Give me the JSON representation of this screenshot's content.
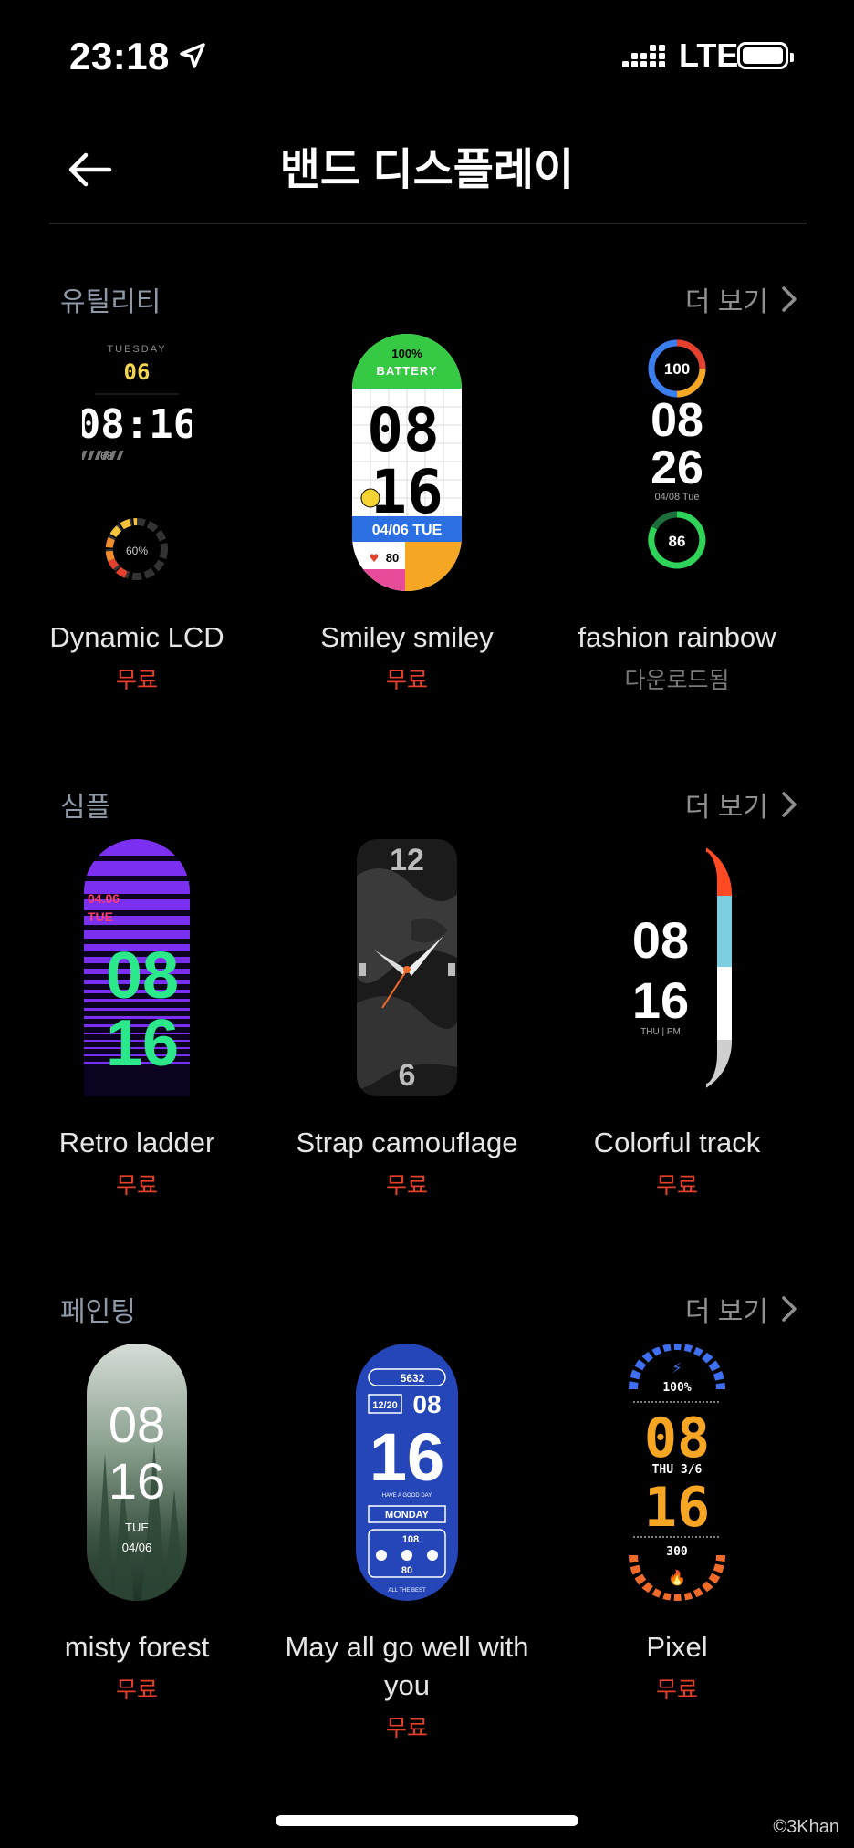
{
  "status_bar": {
    "time": "23:18",
    "network": "LTE"
  },
  "header": {
    "title": "밴드 디스플레이"
  },
  "sections": [
    {
      "title": "유틸리티",
      "more_label": "더 보기",
      "items": [
        {
          "name": "Dynamic LCD",
          "price": "무료",
          "face": {
            "day": "TUESDAY",
            "date": "06",
            "time": "08:16",
            "steps": "68",
            "percent": "60%"
          }
        },
        {
          "name": "Smiley smiley",
          "price": "무료",
          "face": {
            "battery": "100%",
            "battery_label": "BATTERY",
            "hour": "08",
            "minute": "16",
            "date": "04/06 TUE",
            "heart": "80"
          }
        },
        {
          "name": "fashion rainbow",
          "price": "다운로드됨",
          "face": {
            "top": "100",
            "hour": "08",
            "minute": "26",
            "date": "04/08 Tue",
            "bottom": "86"
          }
        }
      ]
    },
    {
      "title": "심플",
      "more_label": "더 보기",
      "items": [
        {
          "name": "Retro ladder",
          "price": "무료",
          "face": {
            "date": "04.06",
            "day": "TUE",
            "hour": "08",
            "minute": "16"
          }
        },
        {
          "name": "Strap camouflage",
          "price": "무료",
          "face": {
            "twelve": "12",
            "six": "6"
          }
        },
        {
          "name": "Colorful track",
          "price": "무료",
          "face": {
            "hour": "08",
            "minute": "16",
            "sub": "THU | PM"
          }
        }
      ]
    },
    {
      "title": "페인팅",
      "more_label": "더 보기",
      "items": [
        {
          "name": "misty forest",
          "price": "무료",
          "face": {
            "hour": "08",
            "minute": "16",
            "day": "TUE",
            "date": "04/06"
          }
        },
        {
          "name": "May all go well with you",
          "price": "무료",
          "face": {
            "steps": "5632",
            "date": "12/20",
            "hour": "08",
            "minute": "16",
            "motto": "HAVE A GOOD DAY",
            "day": "MONDAY",
            "heart": "108",
            "mid": "80",
            "footer": "ALL THE BEST"
          }
        },
        {
          "name": "Pixel",
          "price": "무료",
          "face": {
            "battery": "100%",
            "hour": "08",
            "date": "THU 3/6",
            "minute": "16",
            "calories": "300"
          }
        }
      ]
    }
  ],
  "watermark": "©3Khan",
  "colors": {
    "accent_price": "#e5402b",
    "downloaded": "#7a7a7a",
    "section_title": "#8f9aa8"
  }
}
